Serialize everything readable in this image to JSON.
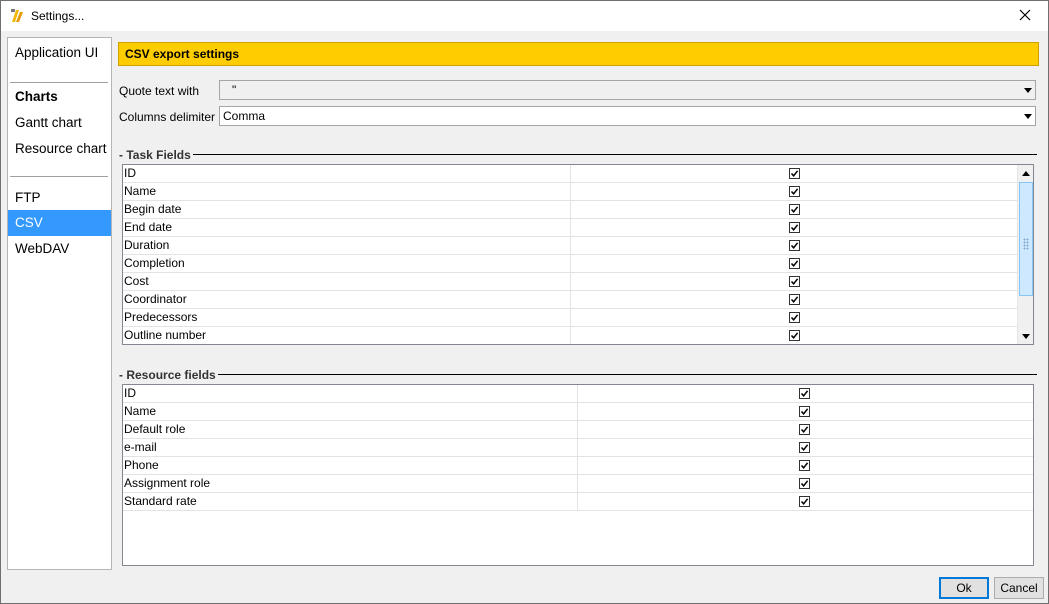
{
  "window": {
    "title": "Settings..."
  },
  "nav": {
    "items": [
      {
        "label": "Application UI"
      },
      {
        "label": "Charts"
      },
      {
        "label": "Gantt chart"
      },
      {
        "label": "Resource chart"
      },
      {
        "label": "FTP"
      },
      {
        "label": "CSV"
      },
      {
        "label": "WebDAV"
      }
    ],
    "selected": "CSV"
  },
  "panel": {
    "header": "CSV export settings",
    "quote": {
      "label": "Quote text with",
      "value": "\""
    },
    "delimiter": {
      "label": "Columns delimiter",
      "value": "Comma"
    }
  },
  "task_fields": {
    "title": "Task Fields",
    "rows": [
      {
        "name": "ID",
        "checked": true
      },
      {
        "name": "Name",
        "checked": true
      },
      {
        "name": "Begin date",
        "checked": true
      },
      {
        "name": "End date",
        "checked": true
      },
      {
        "name": "Duration",
        "checked": true
      },
      {
        "name": "Completion",
        "checked": true
      },
      {
        "name": "Cost",
        "checked": true
      },
      {
        "name": "Coordinator",
        "checked": true
      },
      {
        "name": "Predecessors",
        "checked": true
      },
      {
        "name": "Outline number",
        "checked": true
      }
    ]
  },
  "resource_fields": {
    "title": "Resource fields",
    "rows": [
      {
        "name": "ID",
        "checked": true
      },
      {
        "name": "Name",
        "checked": true
      },
      {
        "name": "Default role",
        "checked": true
      },
      {
        "name": "e-mail",
        "checked": true
      },
      {
        "name": "Phone",
        "checked": true
      },
      {
        "name": "Assignment role",
        "checked": true
      },
      {
        "name": "Standard rate",
        "checked": true
      }
    ]
  },
  "buttons": {
    "ok": "Ok",
    "cancel": "Cancel"
  },
  "colors": {
    "accent": "#3399ff",
    "header": "#ffcc00"
  }
}
